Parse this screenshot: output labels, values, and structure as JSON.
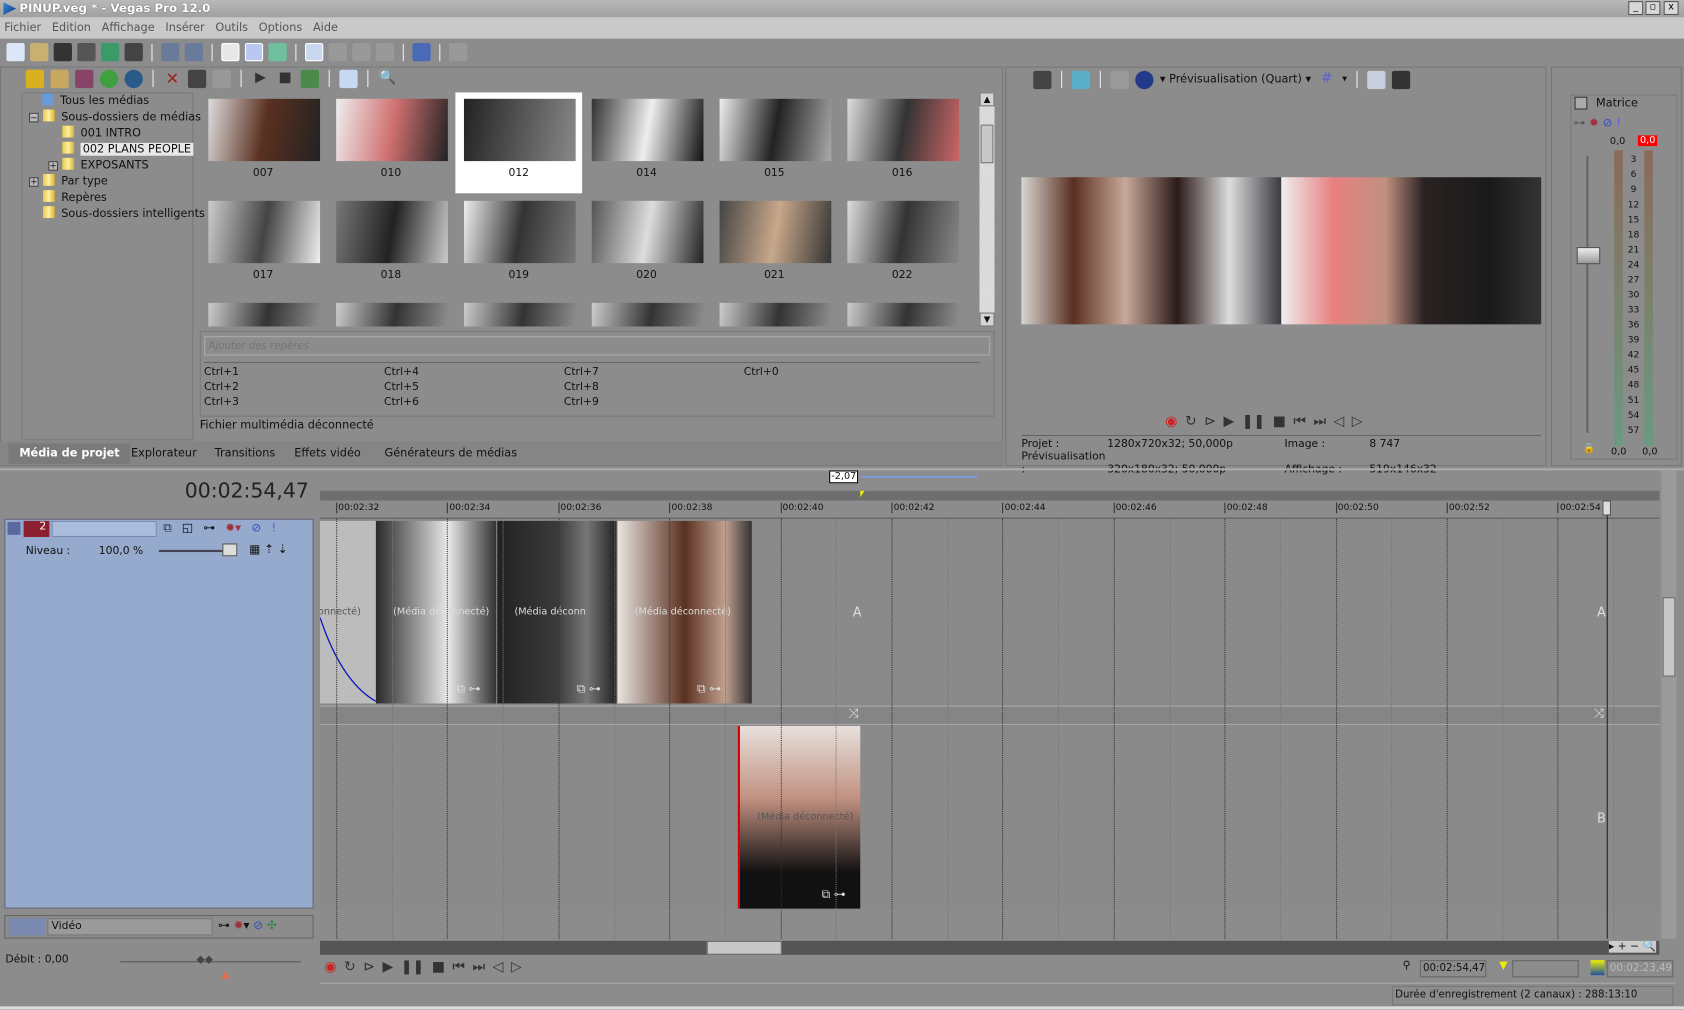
{
  "window": {
    "title": "PINUP.veg * - Vegas Pro 12.0",
    "min": "_",
    "max": "▫",
    "close": "x"
  },
  "menu": [
    "Fichier",
    "Edition",
    "Affichage",
    "Insérer",
    "Outils",
    "Options",
    "Aide"
  ],
  "media": {
    "tree": [
      {
        "label": "Tous les médias"
      },
      {
        "label": "Sous-dossiers de médias"
      },
      {
        "label": "001 INTRO"
      },
      {
        "label": "002 PLANS PEOPLE"
      },
      {
        "label": "EXPOSANTS"
      },
      {
        "label": "Par type"
      },
      {
        "label": "Repères"
      },
      {
        "label": "Sous-dossiers intelligents"
      }
    ],
    "thumbs": [
      {
        "label": "007"
      },
      {
        "label": "010"
      },
      {
        "label": "012"
      },
      {
        "label": "014"
      },
      {
        "label": "015"
      },
      {
        "label": "016"
      },
      {
        "label": "017"
      },
      {
        "label": "018"
      },
      {
        "label": "019"
      },
      {
        "label": "020"
      },
      {
        "label": "021"
      },
      {
        "label": "022"
      }
    ],
    "markers_placeholder": "Ajouter des repères",
    "shortcuts": [
      "Ctrl+1",
      "Ctrl+4",
      "Ctrl+7",
      "Ctrl+0",
      "Ctrl+2",
      "Ctrl+5",
      "Ctrl+8",
      "",
      "Ctrl+3",
      "Ctrl+6",
      "Ctrl+9",
      ""
    ],
    "status": "Fichier multimédia déconnecté",
    "tabs": [
      "Média de projet",
      "Explorateur",
      "Transitions",
      "Effets vidéo",
      "Générateurs de médias"
    ]
  },
  "preview": {
    "quality": "Prévisualisation (Quart)",
    "info": {
      "projet_label": "Projet :",
      "projet": "1280x720x32; 50,000p",
      "prev_label": "Prévisualisation :",
      "prev": "320x180x32; 50,000p",
      "image_label": "Image :",
      "image": "8 747",
      "affichage_label": "Affichage :",
      "affichage": "519x146x32"
    }
  },
  "master": {
    "label": "Matrice",
    "left_peak": "0,0",
    "right_peak": "0,0",
    "scale": [
      "3",
      "6",
      "9",
      "12",
      "15",
      "18",
      "21",
      "24",
      "27",
      "30",
      "33",
      "36",
      "39",
      "42",
      "45",
      "48",
      "51",
      "54",
      "57"
    ],
    "bottom_left": "0,0",
    "bottom_right": "0,0",
    "peak_color": "#ff0000"
  },
  "timeline": {
    "time": "00:02:54,47",
    "rate_marker": "-2,07",
    "ruler": [
      "00:02:32",
      "00:02:34",
      "00:02:36",
      "00:02:38",
      "00:02:40",
      "00:02:42",
      "00:02:44",
      "00:02:46",
      "00:02:48",
      "00:02:50",
      "00:02:52",
      "00:02:54"
    ],
    "track1": {
      "number": "2",
      "level_label": "Niveau :",
      "level": "100,0 %",
      "level_fraction": 1.0,
      "label_a": "A",
      "label_b": "B"
    },
    "clip_text": [
      "onnecté)",
      "(Média déconnecté)",
      "(Média déconn",
      "(Média déconnecté)",
      "(Média déconnecté)"
    ],
    "video_bus": "Vidéo",
    "debit": "Débit : 0,00",
    "cursor": "00:02:54,47",
    "selection_end": "00:02:23,49",
    "record_duration": "Durée d'enregistrement (2 canaux) : 288:13:10",
    "accent": "#1010c0"
  }
}
